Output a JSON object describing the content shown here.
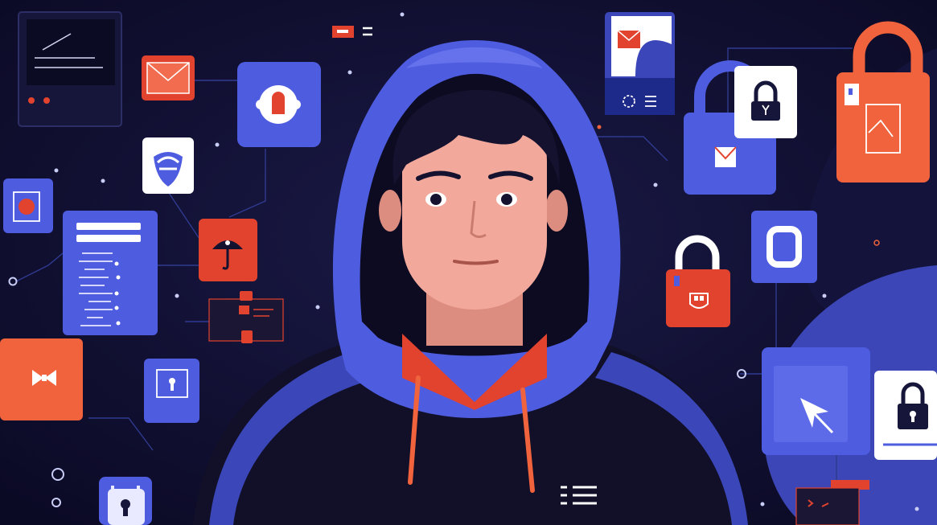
{
  "illustration": {
    "subject": "hooded-person",
    "theme_icons": [
      "padlock-icon",
      "envelope-icon",
      "shield-icon",
      "keyhole-icon",
      "cursor-arrow-icon",
      "menu-lines-icon",
      "document-icon",
      "bow-icon",
      "umbrella-icon"
    ],
    "palette": {
      "background": "#0d0c2b",
      "background_shade": "#1a1946",
      "accent_blue": "#4e5ce0",
      "accent_blue_dark": "#3b46b8",
      "accent_orange": "#f0633c",
      "accent_red": "#e2432f",
      "skin": "#f2a89b",
      "skin_shadow": "#dd8c80",
      "hair": "#14122f",
      "hoodie": "#111028",
      "white": "#ffffff"
    }
  }
}
